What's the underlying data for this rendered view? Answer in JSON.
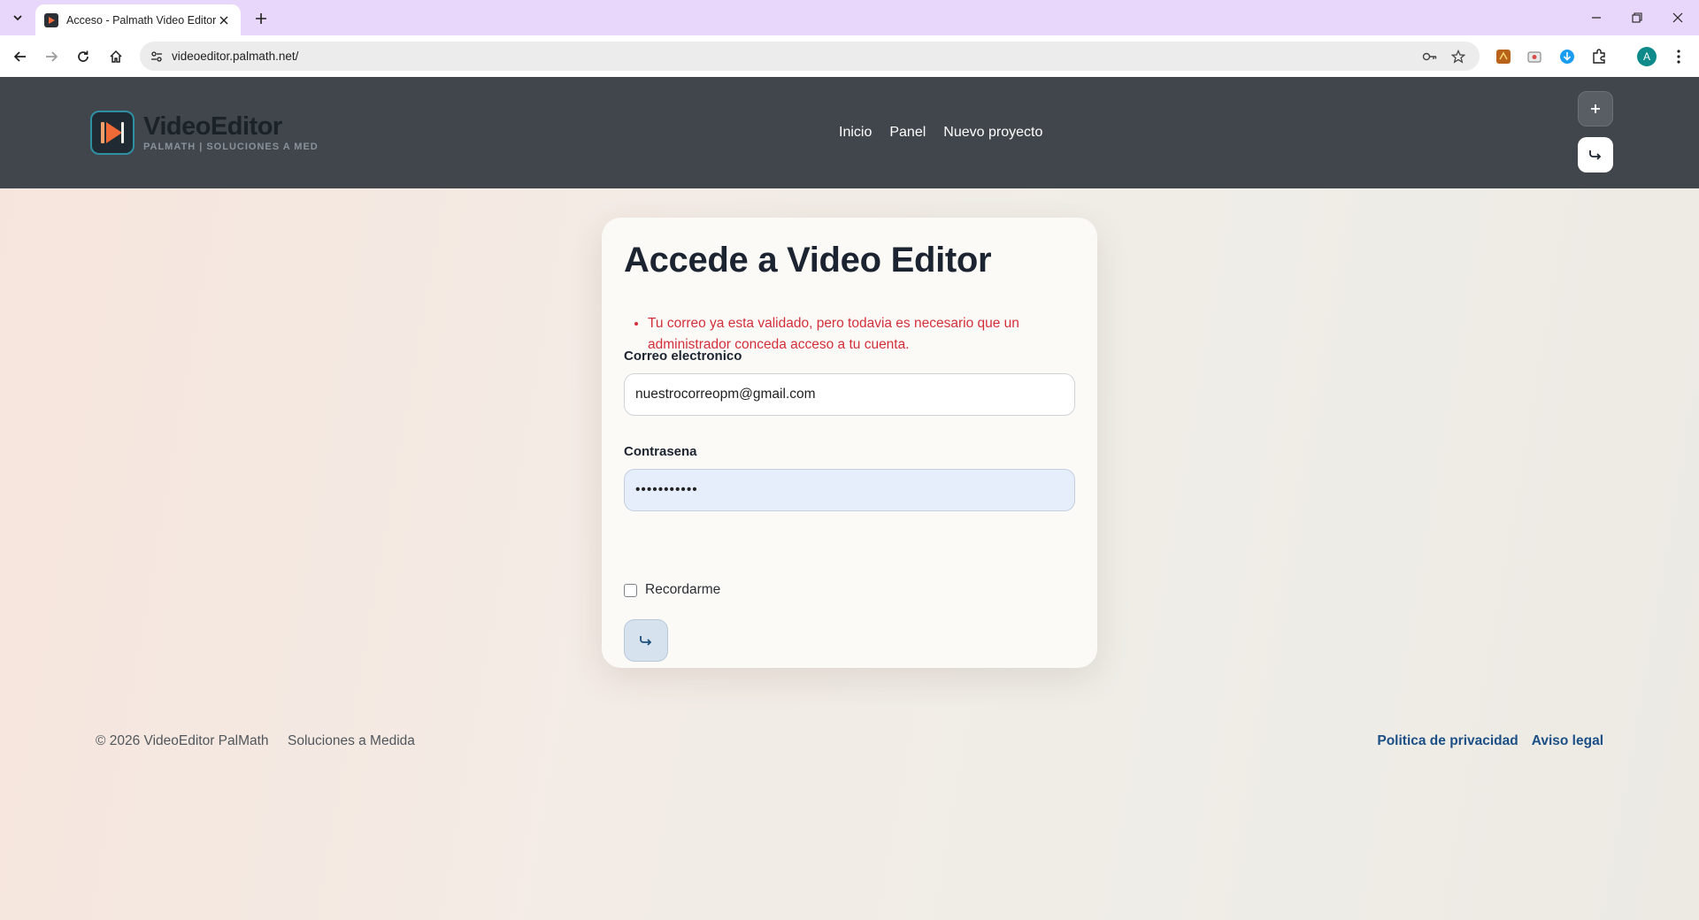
{
  "browser": {
    "tab_title": "Acceso - Palmath Video Editor",
    "url": "videoeditor.palmath.net/",
    "profile_initial": "A"
  },
  "site": {
    "brand_name": "VideoEditor",
    "brand_tagline": "PALMATH | SOLUCIONES A MED",
    "nav": [
      "Inicio",
      "Panel",
      "Nuevo proyecto"
    ]
  },
  "login": {
    "title": "Accede a Video Editor",
    "error": "Tu correo ya esta validado, pero todavia es necesario que un administrador conceda acceso a tu cuenta.",
    "email_label": "Correo electronico",
    "email_value": "nuestrocorreopm@gmail.com",
    "password_label": "Contrasena",
    "password_value": "•••••••••••",
    "remember_label": "Recordarme"
  },
  "footer": {
    "copyright": "© 2026 VideoEditor PalMath",
    "tagline": "Soluciones a Medida",
    "links": [
      "Politica de privacidad",
      "Aviso legal"
    ]
  }
}
